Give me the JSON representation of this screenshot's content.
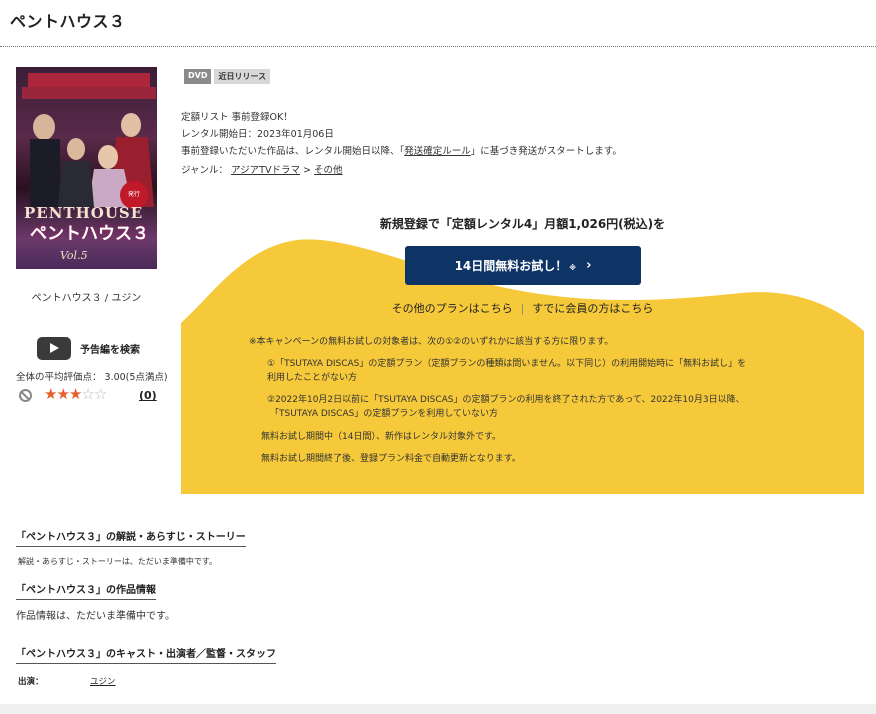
{
  "page": {
    "title": "ペントハウス３"
  },
  "cover": {
    "logo": "PENTHOUSE",
    "title": "ペントハウス３",
    "volume": "Vol.5",
    "badge": "発行",
    "caption": "ペントハウス３ / ユジン"
  },
  "trailer": {
    "label": "予告編を検索"
  },
  "rating": {
    "label": "全体の平均評価点： 3.00(5点満点)",
    "stars_filled": 3,
    "stars_total": 5,
    "review_count": "(0)"
  },
  "tags": [
    "DVD",
    "近日リリース"
  ],
  "info": {
    "line1": "定額リスト 事前登録OK！",
    "line2": "レンタル開始日：2023年01月06日",
    "line3_prefix": "事前登録いただいた作品は、レンタル開始日以降、「",
    "line3_link": "発送確定ルール",
    "line3_suffix": "」に基づき発送がスタートします。",
    "genre_label": "ジャンル：",
    "genre_1": "アジアTVドラマ",
    "genre_arrow": ">",
    "genre_2": "その他"
  },
  "promo": {
    "headline": "新規登録で「定額レンタル4」月額1,026円(税込)を",
    "cta_label": "14日間無料お試し！",
    "cta_note": "※",
    "cta_chevron": "›",
    "other_plans": "その他のプランはこちら",
    "separator": "|",
    "members": "すでに会員の方はこちら",
    "notes": [
      "※本キャンペーンの無料お試しの対象者は、次の①②のいずれかに該当する方に限ります。",
      "①「TSUTAYA DISCAS」の定額プラン（定額プランの種類は問いません。以下同じ）の利用開始時に「無料お試し」を",
      "利用したことがない方",
      "②2022年10月2日以前に「TSUTAYA DISCAS」の定額プランの利用を終了された方であって、2022年10月3日以降、",
      "「TSUTAYA DISCAS」の定額プランを利用していない方",
      "無料お試し期間中（14日間）、新作はレンタル対象外です。",
      "無料お試し期間終了後、登録プラン料金で自動更新となります。"
    ],
    "bg_color": "#f5c93a",
    "cta_color": "#0e3465"
  },
  "sections": {
    "story_head": "「ペントハウス３」の解説・あらすじ・ストーリー",
    "story_text": "解説・あらすじ・ストーリーは、ただいま準備中です。",
    "work_head": "「ペントハウス３」の作品情報",
    "work_text": "作品情報は、ただいま準備中です。",
    "cast_head": "「ペントハウス３」のキャスト・出演者／監督・スタッフ",
    "cast_label": "出演：",
    "cast_value": "ユジン"
  }
}
